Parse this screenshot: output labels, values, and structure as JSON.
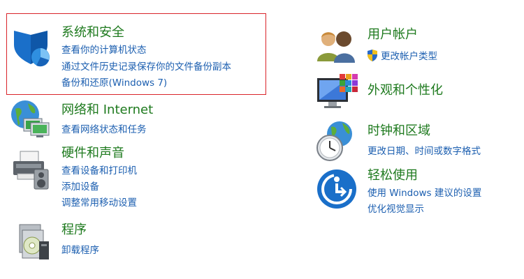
{
  "left": [
    {
      "title": "系统和安全",
      "icon": "shield-security-icon",
      "links": [
        "查看你的计算机状态",
        "通过文件历史记录保存你的文件备份副本",
        "备份和还原(Windows 7)"
      ]
    },
    {
      "title": "网络和 Internet",
      "icon": "network-globe-icon",
      "links": [
        "查看网络状态和任务"
      ]
    },
    {
      "title": "硬件和声音",
      "icon": "printer-speaker-icon",
      "links": [
        "查看设备和打印机",
        "添加设备",
        "调整常用移动设置"
      ]
    },
    {
      "title": "程序",
      "icon": "programs-disc-icon",
      "links": [
        "卸载程序"
      ]
    }
  ],
  "right": [
    {
      "title": "用户帐户",
      "icon": "users-icon",
      "links": [
        "更改帐户类型"
      ]
    },
    {
      "title": "外观和个性化",
      "icon": "monitor-palette-icon",
      "links": []
    },
    {
      "title": "时钟和区域",
      "icon": "clock-globe-icon",
      "links": [
        "更改日期、时间或数字格式"
      ]
    },
    {
      "title": "轻松使用",
      "icon": "ease-of-access-icon",
      "links": [
        "使用 Windows 建议的设置",
        "优化视觉显示"
      ]
    }
  ],
  "colors": {
    "title": "#1e7a1e",
    "link": "#1c5fb0",
    "selection_border": "#d9242a"
  }
}
